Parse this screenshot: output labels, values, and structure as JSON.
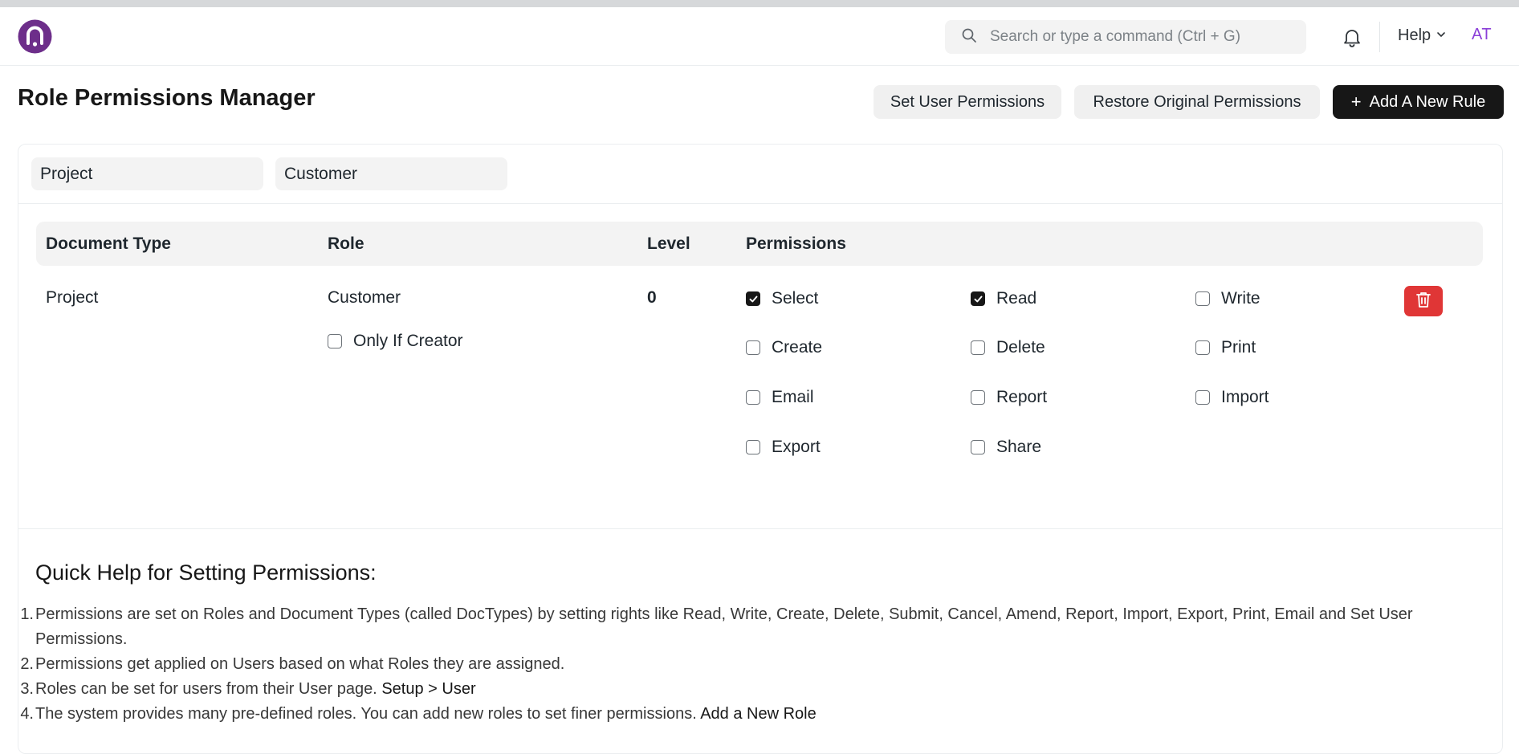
{
  "colors": {
    "accent_dark": "#171717",
    "danger": "#e03636",
    "logo_purple": "#6d2e8a",
    "avatar_text": "#8b3fd8"
  },
  "navbar": {
    "logo_icon": "app-logo-icon",
    "search_placeholder": "Search or type a command (Ctrl + G)",
    "notifications_icon": "bell-icon",
    "help_label": "Help",
    "avatar_initials": "AT"
  },
  "page": {
    "title": "Role Permissions Manager",
    "buttons": {
      "set_user_permissions": "Set User Permissions",
      "restore_original": "Restore Original Permissions",
      "add_new_rule": "Add A New Rule",
      "add_icon": "+"
    }
  },
  "filters": {
    "doctype_value": "Project",
    "role_value": "Customer"
  },
  "table": {
    "headers": [
      "Document Type",
      "Role",
      "Level",
      "Permissions"
    ],
    "rows": [
      {
        "document_type": "Project",
        "role": "Customer",
        "level": "0",
        "only_if_creator": {
          "label": "Only If Creator",
          "checked": false
        },
        "permissions": [
          {
            "label": "Select",
            "checked": true
          },
          {
            "label": "Read",
            "checked": true
          },
          {
            "label": "Write",
            "checked": false
          },
          {
            "label": "Create",
            "checked": false
          },
          {
            "label": "Delete",
            "checked": false
          },
          {
            "label": "Print",
            "checked": false
          },
          {
            "label": "Email",
            "checked": false
          },
          {
            "label": "Report",
            "checked": false
          },
          {
            "label": "Import",
            "checked": false
          },
          {
            "label": "Export",
            "checked": false
          },
          {
            "label": "Share",
            "checked": false
          }
        ]
      }
    ]
  },
  "quick_help": {
    "title": "Quick Help for Setting Permissions:",
    "items": [
      {
        "num": "1.",
        "text": "Permissions are set on Roles and Document Types (called DocTypes) by setting rights like Read, Write, Create, Delete, Submit, Cancel, Amend, Report, Import, Export, Print, Email and Set User Permissions.",
        "link": ""
      },
      {
        "num": "2.",
        "text": "Permissions get applied on Users based on what Roles they are assigned.",
        "link": ""
      },
      {
        "num": "3.",
        "text": "Roles can be set for users from their User page. ",
        "link": "Setup > User"
      },
      {
        "num": "4.",
        "text": "The system provides many pre-defined roles. You can add new roles to set finer permissions. ",
        "link": "Add a New Role"
      }
    ]
  }
}
